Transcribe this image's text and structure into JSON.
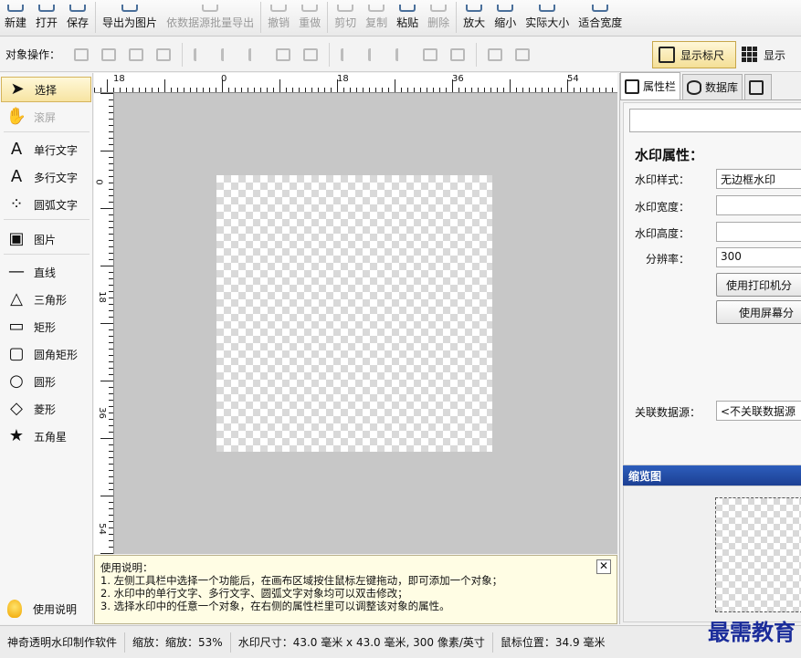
{
  "toolbar": {
    "items": [
      {
        "label": "新建",
        "icon": "new-icon",
        "enabled": true
      },
      {
        "label": "打开",
        "icon": "open-icon",
        "enabled": true
      },
      {
        "label": "保存",
        "icon": "save-icon",
        "enabled": true
      },
      {
        "label": "导出为图片",
        "icon": "export-icon",
        "enabled": true
      },
      {
        "label": "依数据源批量导出",
        "icon": "batch-export-icon",
        "enabled": false
      },
      {
        "label": "撤销",
        "icon": "undo-icon",
        "enabled": false
      },
      {
        "label": "重做",
        "icon": "redo-icon",
        "enabled": false
      },
      {
        "label": "剪切",
        "icon": "cut-icon",
        "enabled": false
      },
      {
        "label": "复制",
        "icon": "copy-icon",
        "enabled": false
      },
      {
        "label": "粘贴",
        "icon": "paste-icon",
        "enabled": true
      },
      {
        "label": "删除",
        "icon": "delete-icon",
        "enabled": false
      },
      {
        "label": "放大",
        "icon": "zoom-in-icon",
        "enabled": true
      },
      {
        "label": "缩小",
        "icon": "zoom-out-icon",
        "enabled": true
      },
      {
        "label": "实际大小",
        "icon": "actual-size-icon",
        "enabled": true
      },
      {
        "label": "适合宽度",
        "icon": "fit-width-icon",
        "enabled": true
      }
    ]
  },
  "objbar": {
    "label": "对象操作：",
    "show_ruler": "显示标尺",
    "show_grid": "显示"
  },
  "tools": {
    "items": [
      {
        "label": "选择",
        "icon": "pointer-icon",
        "glyph": "➤",
        "selected": true,
        "enabled": true
      },
      {
        "label": "滚屏",
        "icon": "hand-icon",
        "glyph": "✋",
        "selected": false,
        "enabled": false
      },
      {
        "label": "单行文字",
        "icon": "single-line-text-icon",
        "glyph": "A",
        "selected": false,
        "enabled": true
      },
      {
        "label": "多行文字",
        "icon": "multi-line-text-icon",
        "glyph": "A",
        "selected": false,
        "enabled": true
      },
      {
        "label": "圆弧文字",
        "icon": "arc-text-icon",
        "glyph": "⁘",
        "selected": false,
        "enabled": true
      },
      {
        "label": "图片",
        "icon": "image-icon",
        "glyph": "▣",
        "selected": false,
        "enabled": true
      },
      {
        "label": "直线",
        "icon": "line-icon",
        "glyph": "—",
        "selected": false,
        "enabled": true
      },
      {
        "label": "三角形",
        "icon": "triangle-icon",
        "glyph": "△",
        "selected": false,
        "enabled": true
      },
      {
        "label": "矩形",
        "icon": "rectangle-icon",
        "glyph": "▭",
        "selected": false,
        "enabled": true
      },
      {
        "label": "圆角矩形",
        "icon": "rounded-rectangle-icon",
        "glyph": "▢",
        "selected": false,
        "enabled": true
      },
      {
        "label": "圆形",
        "icon": "circle-icon",
        "glyph": "○",
        "selected": false,
        "enabled": true
      },
      {
        "label": "菱形",
        "icon": "diamond-icon",
        "glyph": "◇",
        "selected": false,
        "enabled": true
      },
      {
        "label": "五角星",
        "icon": "star-icon",
        "glyph": "★",
        "selected": false,
        "enabled": true
      }
    ],
    "help_label": "使用说明"
  },
  "ruler": {
    "h_labels": [
      "18",
      "0",
      "18",
      "36",
      "54"
    ],
    "v_labels": [
      "0",
      "18",
      "36",
      "54"
    ]
  },
  "help": {
    "title": "使用说明：",
    "lines": [
      "1. 左侧工具栏中选择一个功能后，在画布区域按住鼠标左键拖动，即可添加一个对象；",
      "2. 水印中的单行文字、多行文字、圆弧文字对象均可以双击修改；",
      "3. 选择水印中的任意一个对象，在右侧的属性栏里可以调整该对象的属性。"
    ],
    "close": "✕"
  },
  "panel": {
    "tabs": [
      "属性栏",
      "数据库",
      ""
    ],
    "heading": "水印属性：",
    "style_label": "水印样式：",
    "style_value": "无边框水印",
    "width_label": "水印宽度：",
    "width_value": "",
    "height_label": "水印高度：",
    "height_value": "",
    "dpi_label": "分辨率：",
    "dpi_value": "300",
    "printer_btn": "使用打印机分",
    "screen_btn": "使用屏幕分",
    "datasource_label": "关联数据源：",
    "datasource_value": "<不关联数据源",
    "preview_title": "缩览图"
  },
  "status": {
    "app": "神奇透明水印制作软件",
    "zoom": "缩放：缩放：53%",
    "size": "水印尺寸：43.0 毫米 x 43.0 毫米, 300 像素/英寸",
    "mouse": "鼠标位置：34.9 毫米",
    "watermark_text": "最需教育"
  },
  "colors": {
    "accent": "#f7e4a2",
    "preview_header": "#2d5ebc",
    "canvas": "#c7c7c7"
  }
}
